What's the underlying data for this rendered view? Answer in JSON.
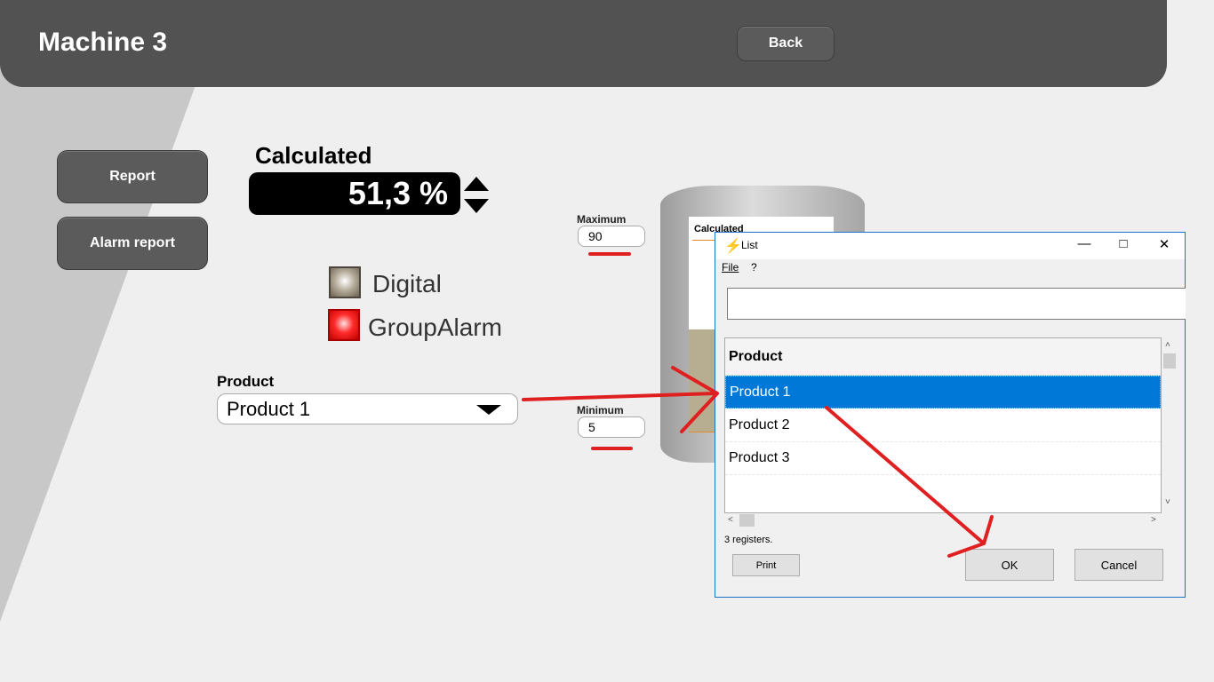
{
  "header": {
    "title": "Machine 3",
    "back_label": "Back"
  },
  "sidebar": {
    "report_label": "Report",
    "alarm_report_label": "Alarm report"
  },
  "calculated": {
    "label": "Calculated",
    "value": "51,3 %"
  },
  "indicators": {
    "digital_label": "Digital",
    "group_alarm_label": "GroupAlarm"
  },
  "product": {
    "label": "Product",
    "selected": "Product 1"
  },
  "limits": {
    "maximum_label": "Maximum",
    "maximum_value": "90",
    "minimum_label": "Minimum",
    "minimum_value": "5"
  },
  "tank": {
    "panel_title": "Calculated"
  },
  "dialog": {
    "title": "List",
    "menu": {
      "file": "File",
      "help": "?"
    },
    "search_value": "",
    "column_header": "Product",
    "rows": [
      "Product 1",
      "Product 2",
      "Product 3"
    ],
    "selected_index": 0,
    "status": "3 registers.",
    "print_label": "Print",
    "ok_label": "OK",
    "cancel_label": "Cancel"
  },
  "colors": {
    "header_bg": "#525252",
    "selection": "#0078d7",
    "annotation": "#e02020",
    "alarm": "#ff2a2a"
  }
}
